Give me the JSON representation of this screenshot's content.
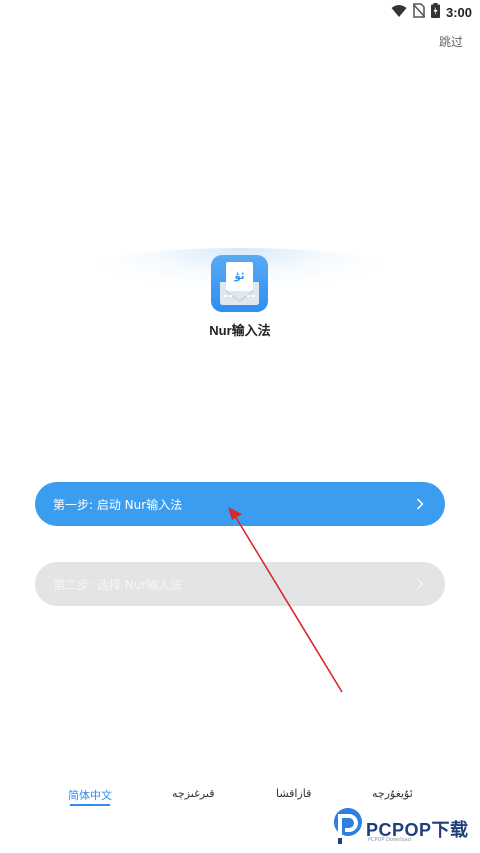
{
  "status_bar": {
    "time": "3:00"
  },
  "header": {
    "skip_label": "跳过"
  },
  "app": {
    "name": "Nur输入法",
    "icon_glyph": "ئۇ"
  },
  "steps": [
    {
      "label": "第一步: 启动 Nur输入法",
      "state": "active"
    },
    {
      "label": "第二步: 选择 Nur输入法",
      "state": "disabled"
    }
  ],
  "languages": [
    {
      "label": "简体中文",
      "active": true
    },
    {
      "label": "قىرغىزچە",
      "active": false
    },
    {
      "label": "قازاقشا",
      "active": false
    },
    {
      "label": "ئۇيغۇرچە",
      "active": false
    }
  ],
  "watermark": {
    "text": "PCPOP下载",
    "subtext": "PCPOP Download"
  },
  "colors": {
    "accent": "#3b9df0",
    "disabled": "#e3e4e6",
    "annotation_arrow": "#d9262b"
  }
}
